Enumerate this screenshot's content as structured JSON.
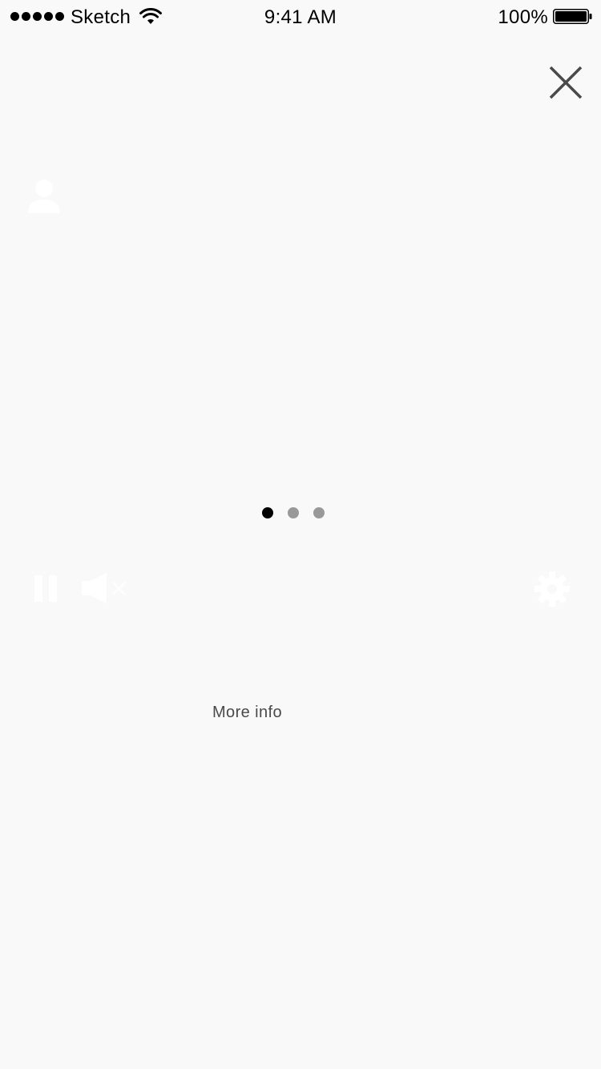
{
  "status_bar": {
    "carrier": "Sketch",
    "time": "9:41 AM",
    "battery_percent": "100%",
    "signal_bars": 5,
    "battery_level": 1.0
  },
  "icons": {
    "close": "close-icon",
    "profile": "person-icon",
    "pause": "pause-icon",
    "mute": "speaker-muted-icon",
    "settings": "gear-icon"
  },
  "pager": {
    "count": 3,
    "active_index": 0
  },
  "links": {
    "more_info": "More info"
  },
  "colors": {
    "background": "#f9f9f9",
    "dot_active": "#000000",
    "dot_inactive": "#999999",
    "link_text": "#4a4a4a",
    "close_icon": "#4a4a4a",
    "control_icons": "#ffffff"
  }
}
